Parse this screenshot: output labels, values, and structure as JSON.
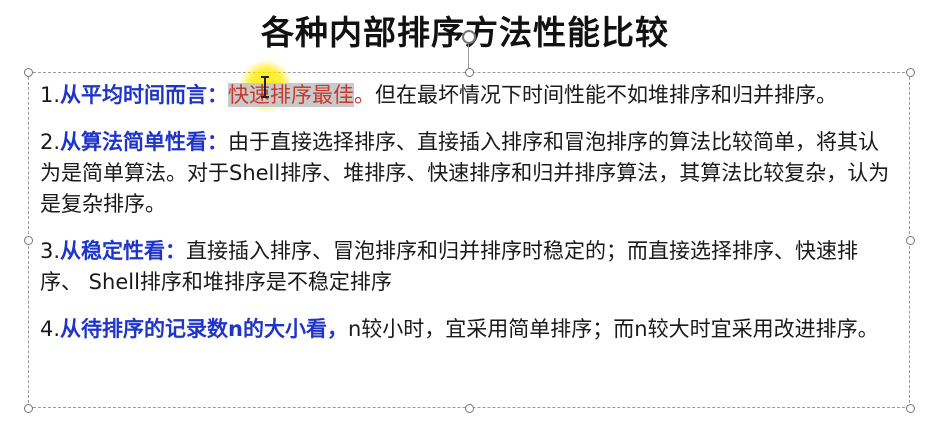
{
  "slide": {
    "title": "各种内部排序方法性能比较"
  },
  "paragraphs": [
    {
      "number": "1.",
      "keyword": "从平均时间而言：",
      "highlight": "快速排序最佳",
      "highlight_tail": "。",
      "text": "但在最坏情况下时间性能不如堆排序和归并排序。"
    },
    {
      "number": "2.",
      "keyword": "从算法简单性看：",
      "text": "由于直接选择排序、直接插入排序和冒泡排序的算法比较简单，将其认为是简单算法。对于Shell排序、堆排序、快速排序和归并排序算法，其算法比较复杂，认为是复杂排序。"
    },
    {
      "number": "3.",
      "keyword": "从稳定性看：",
      "text": "直接插入排序、冒泡排序和归并排序时稳定的；而直接选择排序、快速排序、 Shell排序和堆排序是不稳定排序"
    },
    {
      "number": "4.",
      "keyword": "从待排序的记录数n的大小看，",
      "text": "n较小时，宜采用简单排序；而n较大时宜采用改进排序。"
    }
  ],
  "colors": {
    "keyword": "#1f35c9",
    "highlight_text": "#c8392b",
    "highlight_bg": "#c9c9c9",
    "cursor_glow": "#ffeb00"
  }
}
